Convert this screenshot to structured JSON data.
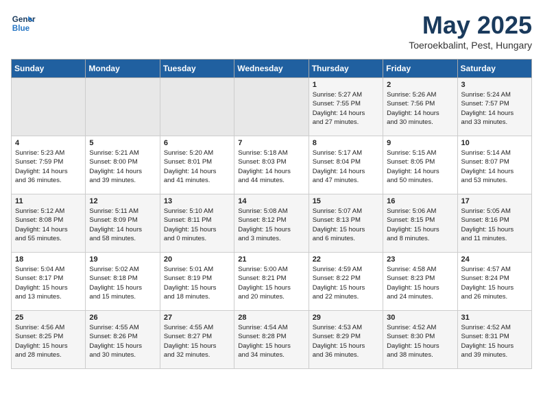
{
  "header": {
    "logo_line1": "General",
    "logo_line2": "Blue",
    "title": "May 2025",
    "subtitle": "Toeroekbalint, Pest, Hungary"
  },
  "days_of_week": [
    "Sunday",
    "Monday",
    "Tuesday",
    "Wednesday",
    "Thursday",
    "Friday",
    "Saturday"
  ],
  "weeks": [
    [
      {
        "num": "",
        "info": ""
      },
      {
        "num": "",
        "info": ""
      },
      {
        "num": "",
        "info": ""
      },
      {
        "num": "",
        "info": ""
      },
      {
        "num": "1",
        "info": "Sunrise: 5:27 AM\nSunset: 7:55 PM\nDaylight: 14 hours\nand 27 minutes."
      },
      {
        "num": "2",
        "info": "Sunrise: 5:26 AM\nSunset: 7:56 PM\nDaylight: 14 hours\nand 30 minutes."
      },
      {
        "num": "3",
        "info": "Sunrise: 5:24 AM\nSunset: 7:57 PM\nDaylight: 14 hours\nand 33 minutes."
      }
    ],
    [
      {
        "num": "4",
        "info": "Sunrise: 5:23 AM\nSunset: 7:59 PM\nDaylight: 14 hours\nand 36 minutes."
      },
      {
        "num": "5",
        "info": "Sunrise: 5:21 AM\nSunset: 8:00 PM\nDaylight: 14 hours\nand 39 minutes."
      },
      {
        "num": "6",
        "info": "Sunrise: 5:20 AM\nSunset: 8:01 PM\nDaylight: 14 hours\nand 41 minutes."
      },
      {
        "num": "7",
        "info": "Sunrise: 5:18 AM\nSunset: 8:03 PM\nDaylight: 14 hours\nand 44 minutes."
      },
      {
        "num": "8",
        "info": "Sunrise: 5:17 AM\nSunset: 8:04 PM\nDaylight: 14 hours\nand 47 minutes."
      },
      {
        "num": "9",
        "info": "Sunrise: 5:15 AM\nSunset: 8:05 PM\nDaylight: 14 hours\nand 50 minutes."
      },
      {
        "num": "10",
        "info": "Sunrise: 5:14 AM\nSunset: 8:07 PM\nDaylight: 14 hours\nand 53 minutes."
      }
    ],
    [
      {
        "num": "11",
        "info": "Sunrise: 5:12 AM\nSunset: 8:08 PM\nDaylight: 14 hours\nand 55 minutes."
      },
      {
        "num": "12",
        "info": "Sunrise: 5:11 AM\nSunset: 8:09 PM\nDaylight: 14 hours\nand 58 minutes."
      },
      {
        "num": "13",
        "info": "Sunrise: 5:10 AM\nSunset: 8:11 PM\nDaylight: 15 hours\nand 0 minutes."
      },
      {
        "num": "14",
        "info": "Sunrise: 5:08 AM\nSunset: 8:12 PM\nDaylight: 15 hours\nand 3 minutes."
      },
      {
        "num": "15",
        "info": "Sunrise: 5:07 AM\nSunset: 8:13 PM\nDaylight: 15 hours\nand 6 minutes."
      },
      {
        "num": "16",
        "info": "Sunrise: 5:06 AM\nSunset: 8:15 PM\nDaylight: 15 hours\nand 8 minutes."
      },
      {
        "num": "17",
        "info": "Sunrise: 5:05 AM\nSunset: 8:16 PM\nDaylight: 15 hours\nand 11 minutes."
      }
    ],
    [
      {
        "num": "18",
        "info": "Sunrise: 5:04 AM\nSunset: 8:17 PM\nDaylight: 15 hours\nand 13 minutes."
      },
      {
        "num": "19",
        "info": "Sunrise: 5:02 AM\nSunset: 8:18 PM\nDaylight: 15 hours\nand 15 minutes."
      },
      {
        "num": "20",
        "info": "Sunrise: 5:01 AM\nSunset: 8:19 PM\nDaylight: 15 hours\nand 18 minutes."
      },
      {
        "num": "21",
        "info": "Sunrise: 5:00 AM\nSunset: 8:21 PM\nDaylight: 15 hours\nand 20 minutes."
      },
      {
        "num": "22",
        "info": "Sunrise: 4:59 AM\nSunset: 8:22 PM\nDaylight: 15 hours\nand 22 minutes."
      },
      {
        "num": "23",
        "info": "Sunrise: 4:58 AM\nSunset: 8:23 PM\nDaylight: 15 hours\nand 24 minutes."
      },
      {
        "num": "24",
        "info": "Sunrise: 4:57 AM\nSunset: 8:24 PM\nDaylight: 15 hours\nand 26 minutes."
      }
    ],
    [
      {
        "num": "25",
        "info": "Sunrise: 4:56 AM\nSunset: 8:25 PM\nDaylight: 15 hours\nand 28 minutes."
      },
      {
        "num": "26",
        "info": "Sunrise: 4:55 AM\nSunset: 8:26 PM\nDaylight: 15 hours\nand 30 minutes."
      },
      {
        "num": "27",
        "info": "Sunrise: 4:55 AM\nSunset: 8:27 PM\nDaylight: 15 hours\nand 32 minutes."
      },
      {
        "num": "28",
        "info": "Sunrise: 4:54 AM\nSunset: 8:28 PM\nDaylight: 15 hours\nand 34 minutes."
      },
      {
        "num": "29",
        "info": "Sunrise: 4:53 AM\nSunset: 8:29 PM\nDaylight: 15 hours\nand 36 minutes."
      },
      {
        "num": "30",
        "info": "Sunrise: 4:52 AM\nSunset: 8:30 PM\nDaylight: 15 hours\nand 38 minutes."
      },
      {
        "num": "31",
        "info": "Sunrise: 4:52 AM\nSunset: 8:31 PM\nDaylight: 15 hours\nand 39 minutes."
      }
    ]
  ]
}
